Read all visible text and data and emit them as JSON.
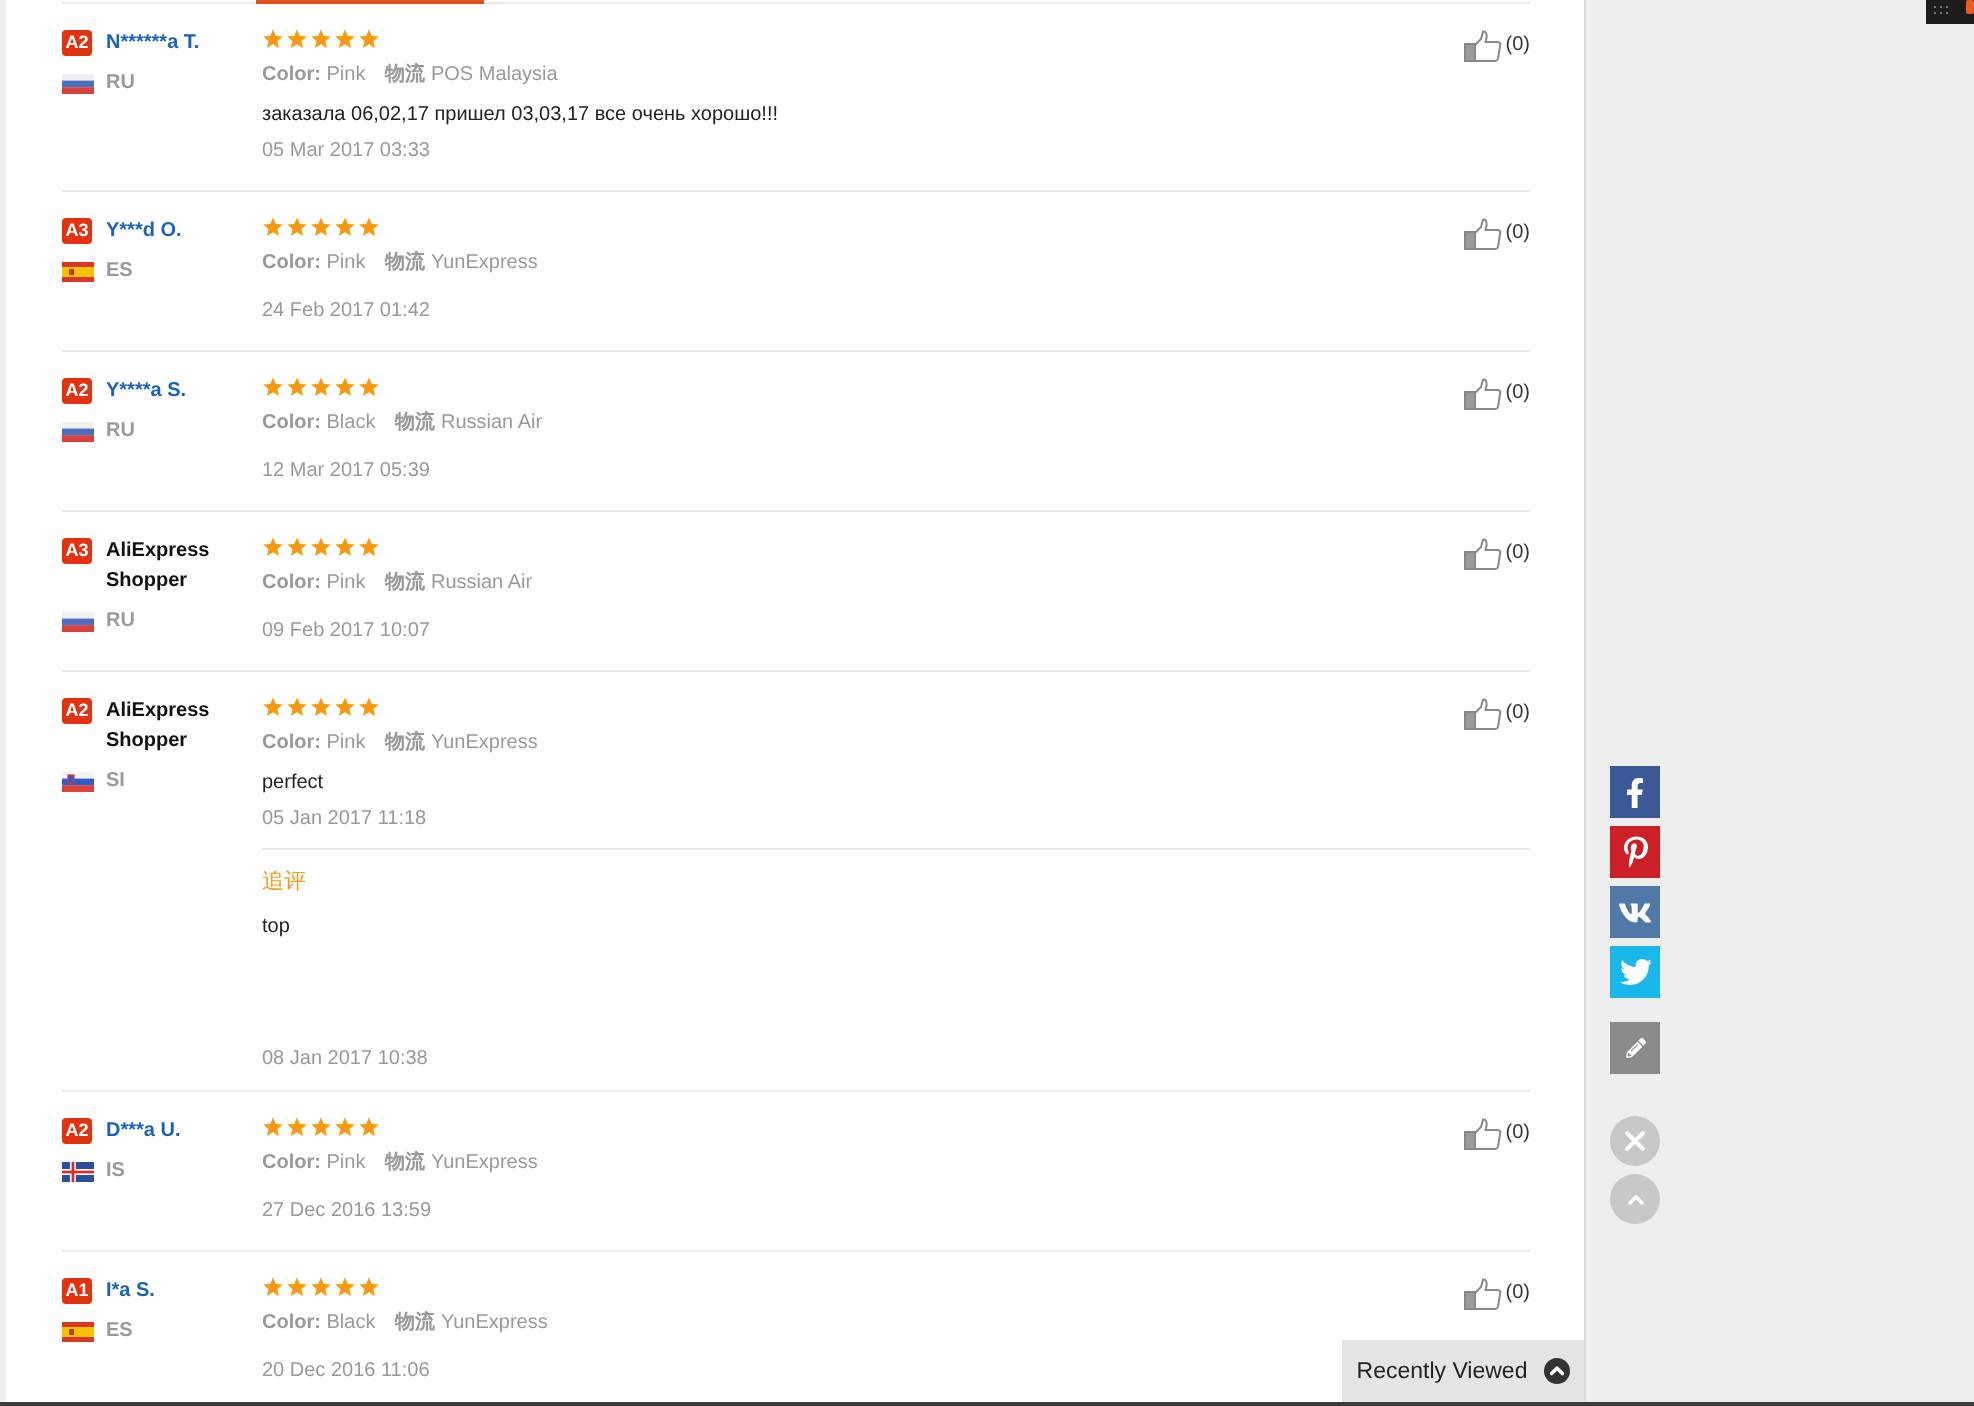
{
  "reviews": [
    {
      "badge": "A2",
      "name": "N******a T.",
      "anonymous": false,
      "flag": {
        "kind": "ru"
      },
      "country": "RU",
      "stars": 5,
      "attributes": [
        {
          "label": "Color:",
          "value": "Pink"
        },
        {
          "label": "物流",
          "value": "POS Malaysia"
        }
      ],
      "text": "заказала 06,02,17 пришел 03,03,17 все очень хорошо!!!",
      "date": "05 Mar 2017 03:33",
      "likes": "(0)"
    },
    {
      "badge": "A3",
      "name": "Y***d O.",
      "anonymous": false,
      "flag": {
        "kind": "es"
      },
      "country": "ES",
      "stars": 5,
      "attributes": [
        {
          "label": "Color:",
          "value": "Pink"
        },
        {
          "label": "物流",
          "value": "YunExpress"
        }
      ],
      "date": "24 Feb 2017 01:42",
      "likes": "(0)"
    },
    {
      "badge": "A2",
      "name": "Y****a S.",
      "anonymous": false,
      "flag": {
        "kind": "ru"
      },
      "country": "RU",
      "stars": 5,
      "attributes": [
        {
          "label": "Color:",
          "value": "Black"
        },
        {
          "label": "物流",
          "value": "Russian Air"
        }
      ],
      "date": "12 Mar 2017 05:39",
      "likes": "(0)"
    },
    {
      "badge": "A3",
      "name": "AliExpress Shopper",
      "anonymous": true,
      "flag": {
        "kind": "ru"
      },
      "country": "RU",
      "stars": 5,
      "attributes": [
        {
          "label": "Color:",
          "value": "Pink"
        },
        {
          "label": "物流",
          "value": "Russian Air"
        }
      ],
      "date": "09 Feb 2017 10:07",
      "likes": "(0)"
    },
    {
      "badge": "A2",
      "name": "AliExpress Shopper",
      "anonymous": true,
      "flag": {
        "kind": "si"
      },
      "country": "SI",
      "stars": 5,
      "attributes": [
        {
          "label": "Color:",
          "value": "Pink"
        },
        {
          "label": "物流",
          "value": "YunExpress"
        }
      ],
      "text": "perfect",
      "date": "05 Jan 2017 11:18",
      "likes": "(0)",
      "followup": {
        "label": "追评",
        "text": "top",
        "date": "08 Jan 2017 10:38"
      }
    },
    {
      "badge": "A2",
      "name": "D***a U.",
      "anonymous": false,
      "flag": {
        "kind": "is"
      },
      "country": "IS",
      "stars": 5,
      "attributes": [
        {
          "label": "Color:",
          "value": "Pink"
        },
        {
          "label": "物流",
          "value": "YunExpress"
        }
      ],
      "date": "27 Dec 2016 13:59",
      "likes": "(0)"
    },
    {
      "badge": "A1",
      "name": "I*a S.",
      "anonymous": false,
      "flag": {
        "kind": "es"
      },
      "country": "ES",
      "stars": 5,
      "attributes": [
        {
          "label": "Color:",
          "value": "Black"
        },
        {
          "label": "物流",
          "value": "YunExpress"
        }
      ],
      "date": "20 Dec 2016 11:06",
      "likes": "(0)"
    }
  ],
  "recently_viewed": {
    "label": "Recently Viewed"
  }
}
